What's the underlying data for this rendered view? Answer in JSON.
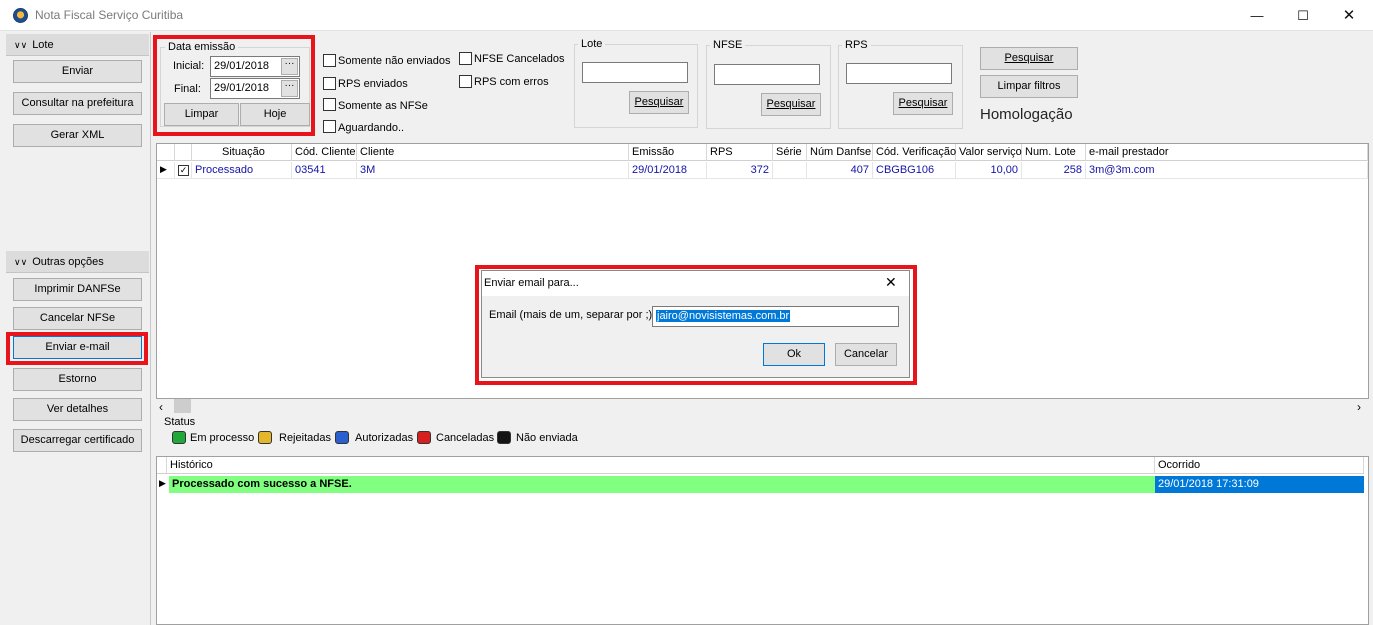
{
  "window": {
    "title": "Nota Fiscal Serviço Curitiba"
  },
  "sidebar": {
    "lote": {
      "title": "Lote",
      "buttons": [
        "Enviar",
        "Consultar na prefeitura",
        "Gerar XML"
      ]
    },
    "outras": {
      "title": "Outras opções",
      "buttons": [
        "Imprimir DANFSe",
        "Cancelar NFSe",
        "Enviar e-mail",
        "Estorno",
        "Ver detalhes",
        "Descarregar certificado"
      ]
    }
  },
  "filters": {
    "data_emissao": {
      "title": "Data emissão",
      "inicial_label": "Inicial:",
      "inicial_value": "29/01/2018",
      "final_label": "Final:",
      "final_value": "29/01/2018",
      "limpar": "Limpar",
      "hoje": "Hoje"
    },
    "checks": [
      "Somente não enviados",
      "RPS enviados",
      "Somente as NFSe",
      "Aguardando..",
      "NFSE Cancelados",
      "RPS com erros"
    ],
    "lote": {
      "title": "Lote",
      "value": "",
      "button": "Pesquisar"
    },
    "nfse": {
      "title": "NFSE",
      "value": "",
      "button": "Pesquisar"
    },
    "rps": {
      "title": "RPS",
      "value": "",
      "button": "Pesquisar"
    },
    "pesquisar": "Pesquisar",
    "limpar_filtros": "Limpar filtros",
    "environment": "Homologação"
  },
  "grid": {
    "columns": [
      "Situação",
      "Cód. Cliente",
      "Cliente",
      "Emissão",
      "RPS",
      "Série",
      "Núm Danfse",
      "Cód. Verificação",
      "Valor serviço",
      "Num. Lote",
      "e-mail prestador"
    ],
    "rows": [
      {
        "checked": "✓",
        "situacao": "Processado",
        "cod_cliente": "03541",
        "cliente": "3M",
        "emissao": "29/01/2018",
        "rps": "372",
        "serie": "",
        "num_danfse": "407",
        "cod_verificacao": "CBGBG106",
        "valor": "10,00",
        "lote": "258",
        "email": "3m@3m.com"
      }
    ]
  },
  "status": {
    "title": "Status",
    "legend": [
      {
        "label": "Em processo",
        "color": "#22a83a"
      },
      {
        "label": "Rejeitadas",
        "color": "#e3b62b"
      },
      {
        "label": "Autorizadas",
        "color": "#2a5fd0"
      },
      {
        "label": "Canceladas",
        "color": "#d62020"
      },
      {
        "label": "Não enviada",
        "color": "#141414"
      }
    ]
  },
  "history": {
    "columns": [
      "Histórico",
      "Ocorrido"
    ],
    "rows": [
      {
        "text": "Processado com sucesso a NFSE.",
        "date": "29/01/2018 17:31:09"
      }
    ]
  },
  "dialog": {
    "title": "Enviar email para...",
    "label": "Email (mais de um, separar por ;)",
    "value": "jairo@novisistemas.com.br",
    "ok": "Ok",
    "cancel": "Cancelar"
  },
  "colors": {
    "highlight": "#e8141c",
    "selection": "#0078d7",
    "history_row": "#80ff80"
  }
}
